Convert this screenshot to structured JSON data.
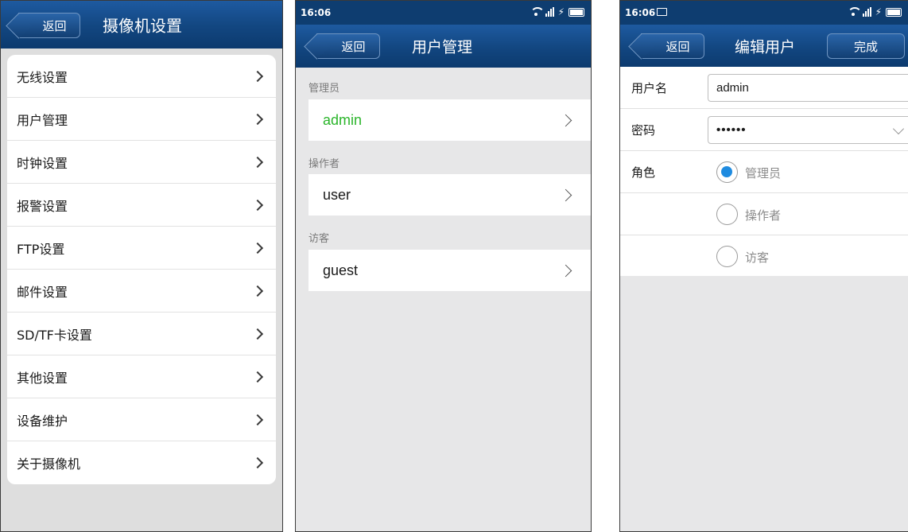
{
  "screen1": {
    "back_label": "返回",
    "title": "摄像机设置",
    "menu": [
      {
        "label": "无线设置"
      },
      {
        "label": "用户管理"
      },
      {
        "label": "时钟设置"
      },
      {
        "label": "报警设置"
      },
      {
        "label": "FTP设置"
      },
      {
        "label": "邮件设置"
      },
      {
        "label": "SD/TF卡设置"
      },
      {
        "label": "其他设置"
      },
      {
        "label": "设备维护"
      },
      {
        "label": "关于摄像机"
      }
    ]
  },
  "screen2": {
    "status_time": "16:06",
    "back_label": "返回",
    "title": "用户管理",
    "sections": [
      {
        "label": "管理员",
        "user": "admin"
      },
      {
        "label": "操作者",
        "user": "user"
      },
      {
        "label": "访客",
        "user": "guest"
      }
    ]
  },
  "screen3": {
    "status_time": "16:06",
    "back_label": "返回",
    "title": "编辑用户",
    "done_label": "完成",
    "username_label": "用户名",
    "username_value": "admin",
    "password_label": "密码",
    "password_value": "••••••",
    "role_label": "角色",
    "roles": [
      {
        "label": "管理员",
        "selected": true
      },
      {
        "label": "操作者",
        "selected": false
      },
      {
        "label": "访客",
        "selected": false
      }
    ]
  },
  "colors": {
    "navbar": "#124680",
    "admin_text": "#2bb52b",
    "radio_selected": "#1e8be0"
  }
}
